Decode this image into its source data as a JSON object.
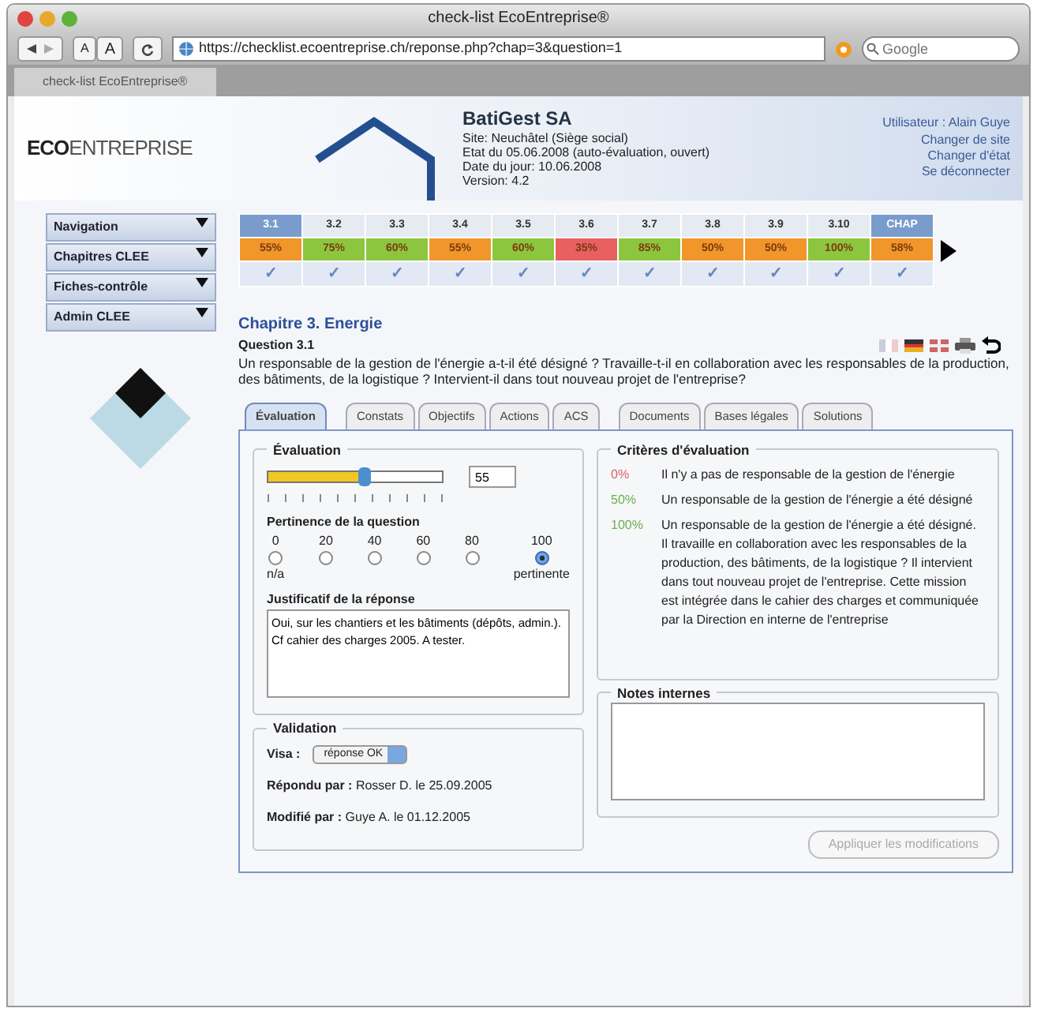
{
  "browser": {
    "title": "check-list EcoEntreprise®",
    "font_buttons": [
      "A",
      "A"
    ],
    "url": "https://checklist.ecoentreprise.ch/reponse.php?chap=3&question=1",
    "search_placeholder": "Google",
    "tab": "check-list EcoEntreprise®"
  },
  "header": {
    "logo_bold": "ECO",
    "logo_light": "ENTREPRISE",
    "company": "BatiGest SA",
    "details": [
      "Site: Neuchâtel (Siège social)",
      "Etat du 05.06.2008 (auto-évaluation, ouvert)",
      "Date du jour: 10.06.2008",
      "Version: 4.2"
    ],
    "user_label": "Utilisateur :",
    "user_name": "Alain Guye",
    "links": [
      "Changer de site",
      "Changer d'état",
      "Se déconnecter"
    ]
  },
  "sidebar": {
    "menus": [
      "Navigation",
      "Chapitres CLEE",
      "Fiches-contrôle",
      "Admin CLEE"
    ]
  },
  "grid": {
    "columns": [
      {
        "label": "3.1",
        "percent": "55%",
        "color": "#f0962a",
        "selected": true,
        "check": "✓"
      },
      {
        "label": "3.2",
        "percent": "75%",
        "color": "#8cc63f",
        "selected": false,
        "check": "✓"
      },
      {
        "label": "3.3",
        "percent": "60%",
        "color": "#8cc63f",
        "selected": false,
        "check": "✓"
      },
      {
        "label": "3.4",
        "percent": "55%",
        "color": "#f0962a",
        "selected": false,
        "check": "✓"
      },
      {
        "label": "3.5",
        "percent": "60%",
        "color": "#8cc63f",
        "selected": false,
        "check": "✓"
      },
      {
        "label": "3.6",
        "percent": "35%",
        "color": "#e86060",
        "selected": false,
        "check": "✓"
      },
      {
        "label": "3.7",
        "percent": "85%",
        "color": "#8cc63f",
        "selected": false,
        "check": "✓"
      },
      {
        "label": "3.8",
        "percent": "50%",
        "color": "#f0962a",
        "selected": false,
        "check": "✓"
      },
      {
        "label": "3.9",
        "percent": "50%",
        "color": "#f0962a",
        "selected": false,
        "check": "✓"
      },
      {
        "label": "3.10",
        "percent": "100%",
        "color": "#8cc63f",
        "selected": false,
        "check": "✓"
      },
      {
        "label": "CHAP",
        "percent": "58%",
        "color": "#f0962a",
        "selected": true,
        "check": "✓"
      }
    ]
  },
  "question": {
    "chapter": "Chapitre 3. Energie",
    "label": "Question 3.1",
    "text": "Un responsable de la gestion de l'énergie a-t-il été désigné ? Travaille-t-il en collaboration avec les responsables de la production, des bâtiments, de la logistique ? Intervient-il dans tout nouveau projet de l'entreprise?"
  },
  "tabs": [
    {
      "label": "Évaluation",
      "selected": true
    },
    {
      "label": "Constats",
      "selected": false
    },
    {
      "label": "Objectifs",
      "selected": false
    },
    {
      "label": "Actions",
      "selected": false
    },
    {
      "label": "ACS",
      "selected": false
    },
    {
      "label": "Documents",
      "selected": false
    },
    {
      "label": "Bases légales",
      "selected": false
    },
    {
      "label": "Solutions",
      "selected": false
    }
  ],
  "evaluation": {
    "legend": "Évaluation",
    "level": 0.55,
    "value": "55",
    "pertinence_title": "Pertinence de la question",
    "options": [
      {
        "value": "0",
        "caption": "n/a",
        "selected": false
      },
      {
        "value": "20",
        "selected": false
      },
      {
        "value": "40",
        "selected": false
      },
      {
        "value": "60",
        "selected": false
      },
      {
        "value": "80",
        "selected": false
      },
      {
        "value": "100",
        "caption": "pertinente",
        "selected": true
      }
    ],
    "justification_label": "Justificatif de la réponse",
    "justification": "Oui, sur les chantiers et les bâtiments (dépôts, admin.). Cf cahier des charges 2005. A tester."
  },
  "validation": {
    "legend": "Validation",
    "visa_label": "Visa :",
    "visa_value": "réponse OK",
    "answered_label": "Répondu par :",
    "answered_by": "Rosser D.  le 25.09.2005",
    "modified_label": "Modifié par :",
    "modified_by": "Guye A.  le 01.12.2005"
  },
  "criteria": {
    "legend": "Critères d'évaluation",
    "items": [
      {
        "percent": "0%",
        "color": "#e06060",
        "text": "Il n'y a pas de responsable de la gestion de l'énergie"
      },
      {
        "percent": "50%",
        "color": "#6ab04c",
        "text": "Un responsable de la gestion de l'énergie a été désigné"
      },
      {
        "percent": "100%",
        "color": "#6ab04c",
        "text": "Un responsable de la gestion de l'énergie a été désigné. Il travaille en collaboration avec les responsables de la production, des bâtiments, de la logistique ? Il intervient dans tout nouveau projet de l'entreprise. Cette mission est intégrée dans le cahier des charges et communiquée par la Direction en interne de l'entreprise"
      }
    ]
  },
  "notes": {
    "legend": "Notes internes"
  },
  "apply_button": {
    "label": "Appliquer les modifications",
    "disabled": true
  }
}
